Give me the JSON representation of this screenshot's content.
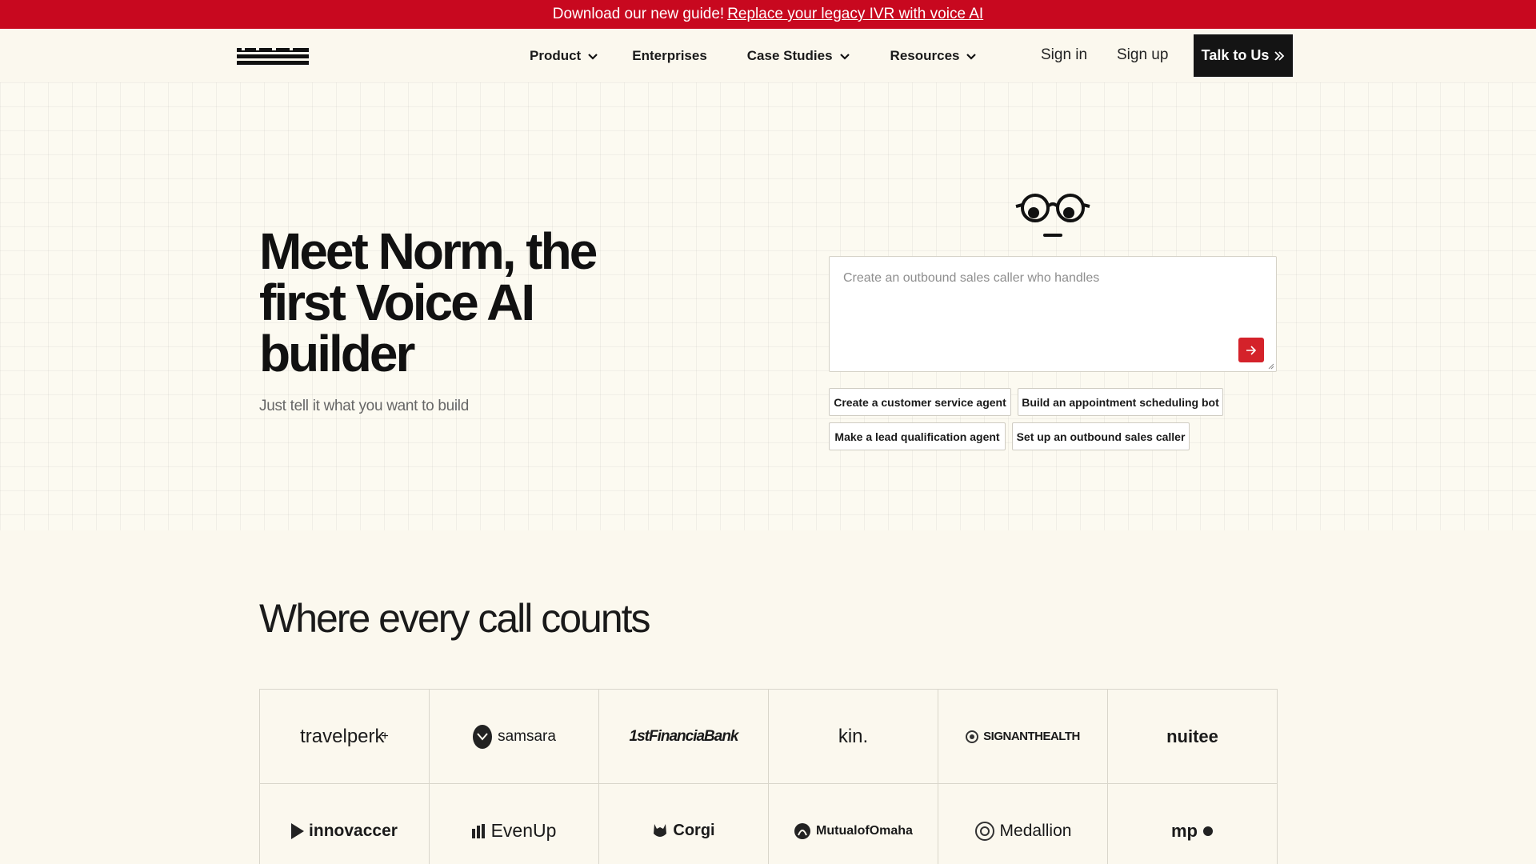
{
  "banner": {
    "text": "Download our new guide!",
    "link": "Replace your legacy IVR with voice AI"
  },
  "nav": {
    "items": [
      {
        "label": "Product",
        "dropdown": true
      },
      {
        "label": "Enterprises",
        "dropdown": false
      },
      {
        "label": "Case Studies",
        "dropdown": true
      },
      {
        "label": "Resources",
        "dropdown": true
      }
    ],
    "sign_in": "Sign in",
    "sign_up": "Sign up",
    "cta": "Talk to Us"
  },
  "hero": {
    "headline": "Meet Norm, the first Voice AI builder",
    "subhead": "Just tell it what you want to build",
    "prompt_placeholder": "Create an outbound sales caller who handles",
    "chips": [
      "Create a customer service agent",
      "Build an appointment scheduling bot",
      "Make a lead qualification agent",
      "Set up an outbound sales caller"
    ]
  },
  "customers": {
    "title": "Where every call counts",
    "logos": [
      "travelperk",
      "samsara",
      "1stFinanciaBank",
      "kin.",
      "SIGNANTHEALTH",
      "nuitee",
      "innovaccer",
      "EvenUp",
      "Corgi",
      "MutualofOmaha",
      "Medallion",
      "mp"
    ]
  },
  "colors": {
    "banner": "#c8081f",
    "background": "#fbf8ee",
    "cta": "#141414",
    "send": "#d4222a"
  }
}
